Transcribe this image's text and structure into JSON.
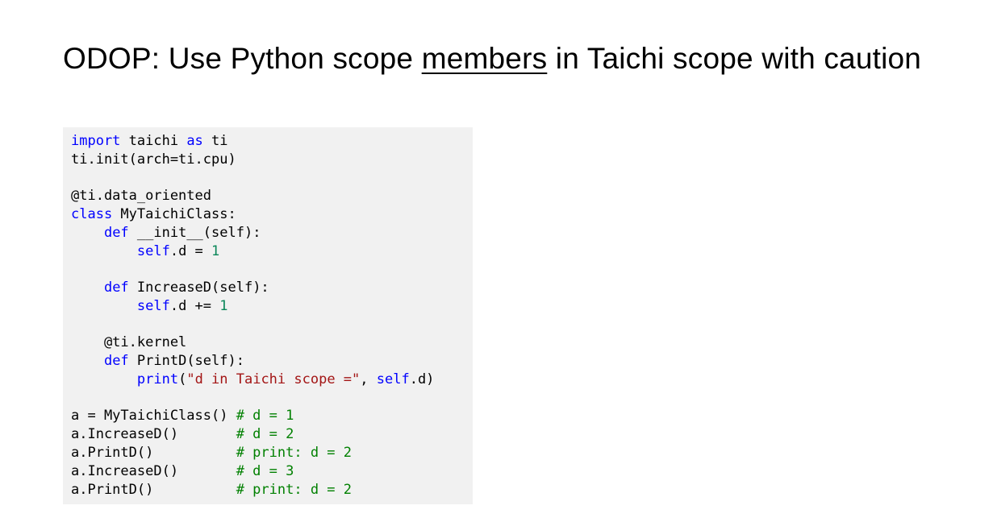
{
  "slide": {
    "title_prefix": "ODOP: Use Python scope ",
    "title_underlined": "members",
    "title_suffix": " in Taichi scope with caution"
  },
  "code": {
    "l1_kw": "import",
    "l1_a": " taichi ",
    "l1_kw2": "as",
    "l1_b": " ti",
    "l2": "ti.init(arch=ti.cpu)",
    "l3": "@ti.data_oriented",
    "l4_kw": "class",
    "l4_a": " MyTaichiClass:",
    "l5_indent": "    ",
    "l5_kw": "def",
    "l5_a": " __init__(self):",
    "l6_indent": "        ",
    "l6_self": "self",
    "l6_a": ".d = ",
    "l6_num": "1",
    "l7_indent": "    ",
    "l7_kw": "def",
    "l7_a": " IncreaseD(self):",
    "l8_indent": "        ",
    "l8_self": "self",
    "l8_a": ".d += ",
    "l8_num": "1",
    "l9": "    @ti.kernel",
    "l10_indent": "    ",
    "l10_kw": "def",
    "l10_a": " PrintD(self):",
    "l11_indent": "        ",
    "l11_kw": "print",
    "l11_a": "(",
    "l11_str": "\"d in Taichi scope =\"",
    "l11_b": ", ",
    "l11_self": "self",
    "l11_c": ".d)",
    "l12_a": "a = MyTaichiClass() ",
    "l12_cmt": "# d = 1",
    "l13_a": "a.IncreaseD()       ",
    "l13_cmt": "# d = 2",
    "l14_a": "a.PrintD()          ",
    "l14_cmt": "# print: d = 2",
    "l15_a": "a.IncreaseD()       ",
    "l15_cmt": "# d = 3",
    "l16_a": "a.PrintD()          ",
    "l16_cmt": "# print: d = 2"
  },
  "colors": {
    "keyword": "#0000ff",
    "number": "#098658",
    "string": "#a31515",
    "comment": "#008000",
    "code_background": "#f1f1f1"
  }
}
